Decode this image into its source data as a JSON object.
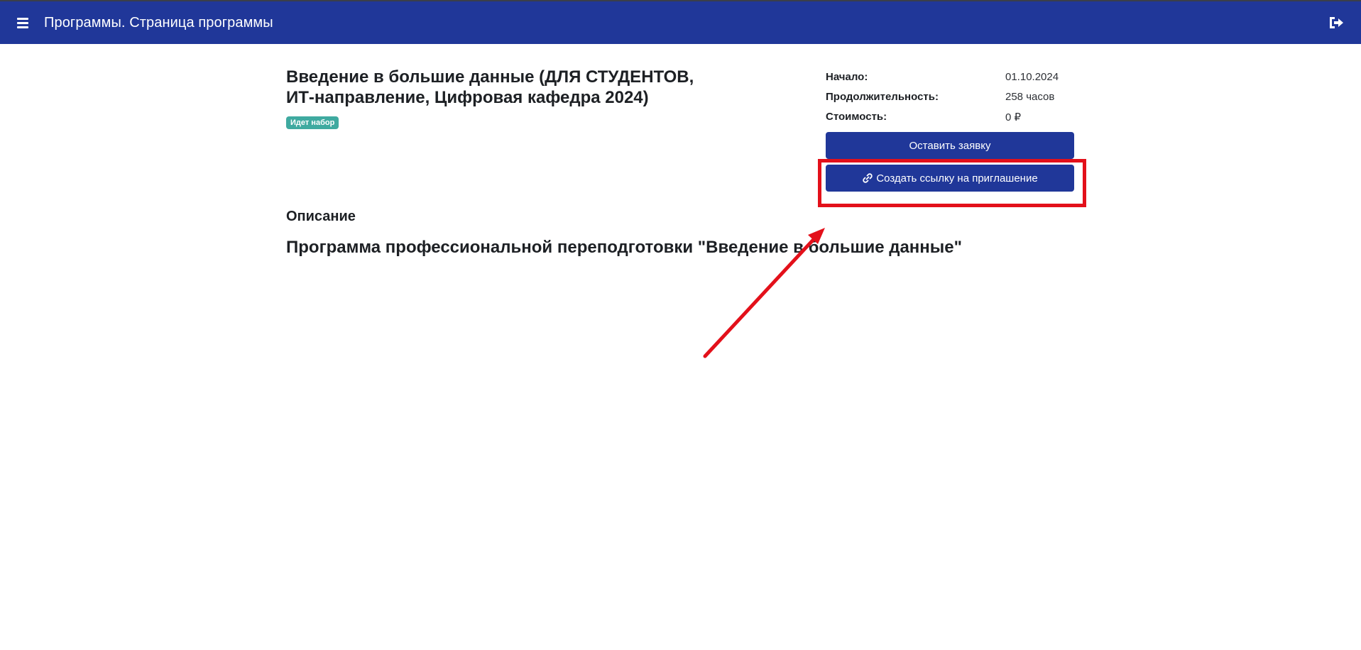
{
  "header": {
    "title": "Программы. Страница программы",
    "menu_icon": "hamburger-menu-icon",
    "logout_icon": "sign-out-icon",
    "background_color": "#203799"
  },
  "program": {
    "title": "Введение в большие данные (ДЛЯ СТУДЕНТОВ, ИТ-направление, Цифровая кафедра 2024)",
    "status_badge": "Идет набор",
    "status_color": "#3faaa0"
  },
  "info": {
    "start_label": "Начало:",
    "start_value": "01.10.2024",
    "duration_label": "Продолжительность:",
    "duration_value": "258 часов",
    "cost_label": "Стоимость:",
    "cost_value": "0 ₽"
  },
  "actions": {
    "apply_label": "Оставить заявку",
    "invite_label": "Создать ссылку на приглашение",
    "invite_icon": "link-icon"
  },
  "description": {
    "heading": "Описание",
    "text": "Программа профессиональной переподготовки \"Введение в большие данные\""
  },
  "annotation": {
    "highlight_color": "#e3101a"
  }
}
